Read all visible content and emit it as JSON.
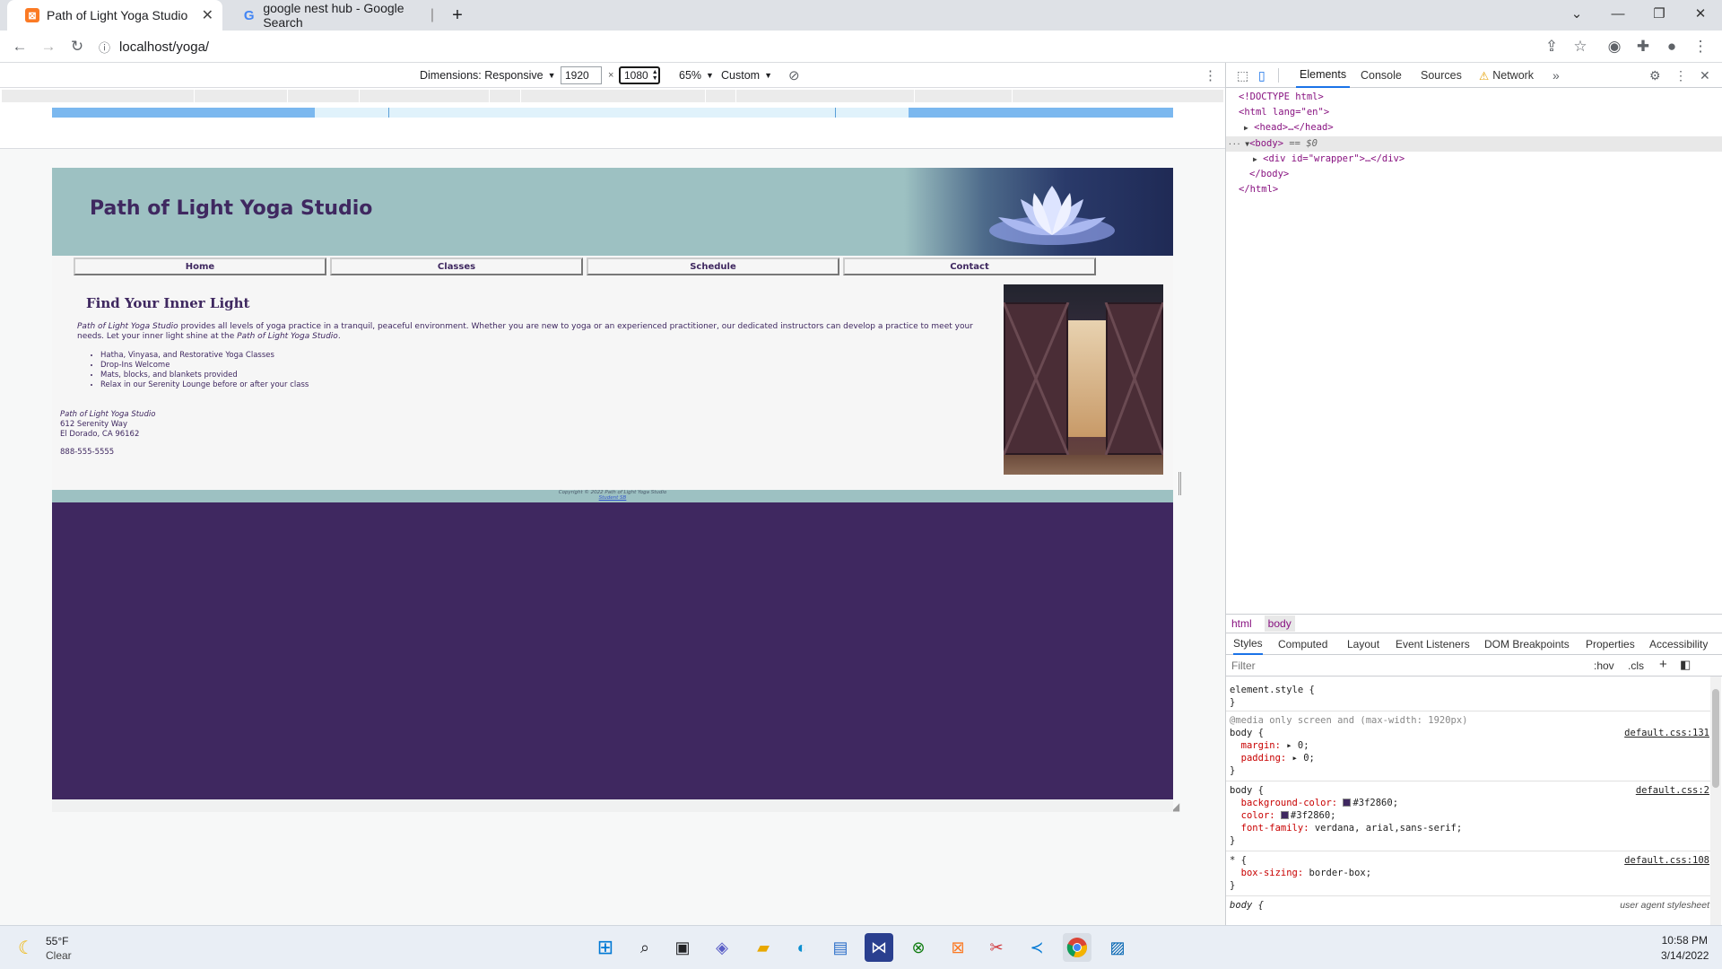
{
  "browser": {
    "tabs": [
      {
        "title": "Path of Light Yoga Studio",
        "favicon": "xampp-icon",
        "active": true
      },
      {
        "title": "google nest hub - Google Search",
        "favicon": "google-icon",
        "active": false
      }
    ],
    "new_tab_symbol": "+",
    "url": "localhost/yoga/"
  },
  "device_toolbar": {
    "dimensions_label": "Dimensions: Responsive",
    "width": "1920",
    "height": "1080",
    "times": "×",
    "zoom": "65%",
    "throttle": "Custom"
  },
  "site": {
    "title": "Path of Light Yoga Studio",
    "nav": [
      "Home",
      "Classes",
      "Schedule",
      "Contact"
    ],
    "heading": "Find Your Inner Light",
    "para_italic_1": "Path of Light Yoga Studio",
    "para_text_1": " provides all levels of yoga practice in a tranquil, peaceful environment. Whether you are new to yoga or an experienced practitioner, our dedicated instructors can develop a practice to meet your needs. Let your inner light shine at the ",
    "para_italic_2": "Path of Light Yoga Studio",
    "para_text_2": ".",
    "list": [
      "Hatha, Vinyasa, and Restorative Yoga Classes",
      "Drop-Ins Welcome",
      "Mats, blocks, and blankets provided",
      "Relax in our Serenity Lounge before or after your class"
    ],
    "address_name": "Path of Light Yoga Studio",
    "address_line1": "612 Serenity Way",
    "address_line2": "El Dorado, CA 96162",
    "phone": "888-555-5555",
    "footer_copyright": "Copyright © 2022 Path of Light Yoga Studio",
    "footer_link": "Student SB",
    "colors": {
      "header": "#9dc1c2",
      "text": "#3f2860",
      "background": "#3f2860"
    }
  },
  "devtools": {
    "tabs": [
      "Elements",
      "Console",
      "Sources",
      "Network"
    ],
    "more": "»",
    "dom": {
      "doctype": "<!DOCTYPE html>",
      "html_open": "<html lang=\"en\">",
      "head": "<head>…</head>",
      "body_open": "<body>",
      "body_eq": "== $0",
      "div": "<div id=\"wrapper\">…</div>",
      "body_close": "</body>",
      "html_close": "</html>"
    },
    "breadcrumbs": [
      "html",
      "body"
    ],
    "subtabs": [
      "Styles",
      "Computed",
      "Layout",
      "Event Listeners",
      "DOM Breakpoints",
      "Properties",
      "Accessibility"
    ],
    "filter_placeholder": "Filter",
    "filter_hov": ":hov",
    "filter_cls": ".cls",
    "rules": {
      "element_style": "element.style {",
      "media": "@media only screen and (max-width: 1920px)",
      "body_sel": "body {",
      "src1": "default.css:131",
      "margin": "margin:",
      "margin_val": "0;",
      "padding": "padding:",
      "padding_val": "0;",
      "src2": "default.css:2",
      "bgcolor": "background-color:",
      "bgcolor_val": "#3f2860;",
      "color": "color:",
      "color_val": "#3f2860;",
      "font": "font-family:",
      "font_val": "verdana, arial,sans-serif;",
      "star_sel": "* {",
      "src3": "default.css:108",
      "boxsizing": "box-sizing:",
      "boxsizing_val": "border-box;",
      "ua_sel": "body {",
      "ua_src": "user agent stylesheet",
      "close": "}"
    }
  },
  "taskbar": {
    "weather_temp": "55°F",
    "weather_desc": "Clear",
    "time": "10:58 PM",
    "date": "3/14/2022"
  }
}
